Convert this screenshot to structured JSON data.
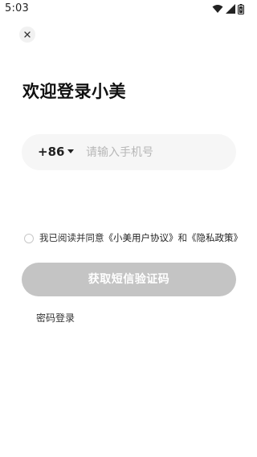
{
  "status_bar": {
    "time": "5:03"
  },
  "icons": {
    "close": "close-icon",
    "wifi": "wifi-icon",
    "signal": "signal-icon",
    "battery": "battery-icon",
    "dropdown": "chevron-down-icon"
  },
  "login": {
    "title": "欢迎登录小美",
    "country_code": "+86",
    "phone_placeholder": "请输入手机号",
    "phone_value": "",
    "agreement": {
      "prefix": "我已阅读并同意",
      "user_agreement": "《小美用户协议》",
      "conjunction": "和",
      "privacy_policy": "《隐私政策》"
    },
    "sms_button": "获取短信验证码",
    "password_login": "密码登录"
  },
  "colors": {
    "button_disabled": "#c4c4c4",
    "input_bg": "#f6f6f6"
  }
}
